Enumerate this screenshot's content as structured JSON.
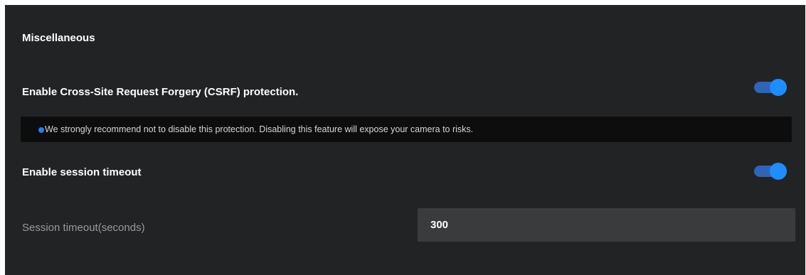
{
  "section": {
    "title": "Miscellaneous"
  },
  "csrf": {
    "label": "Enable Cross-Site Request Forgery (CSRF) protection.",
    "enabled": true,
    "warning": "We strongly recommend not to disable this protection. Disabling this feature will expose your camera to risks."
  },
  "session_timeout": {
    "label": "Enable session timeout",
    "enabled": true,
    "field_label": "Session timeout(seconds)",
    "value": "300"
  },
  "colors": {
    "panel_bg": "#222324",
    "toggle_track": "#2f64b8",
    "toggle_knob": "#1f8cff",
    "warning_bg": "#0d0d0e",
    "input_bg": "#3a3b3d"
  }
}
